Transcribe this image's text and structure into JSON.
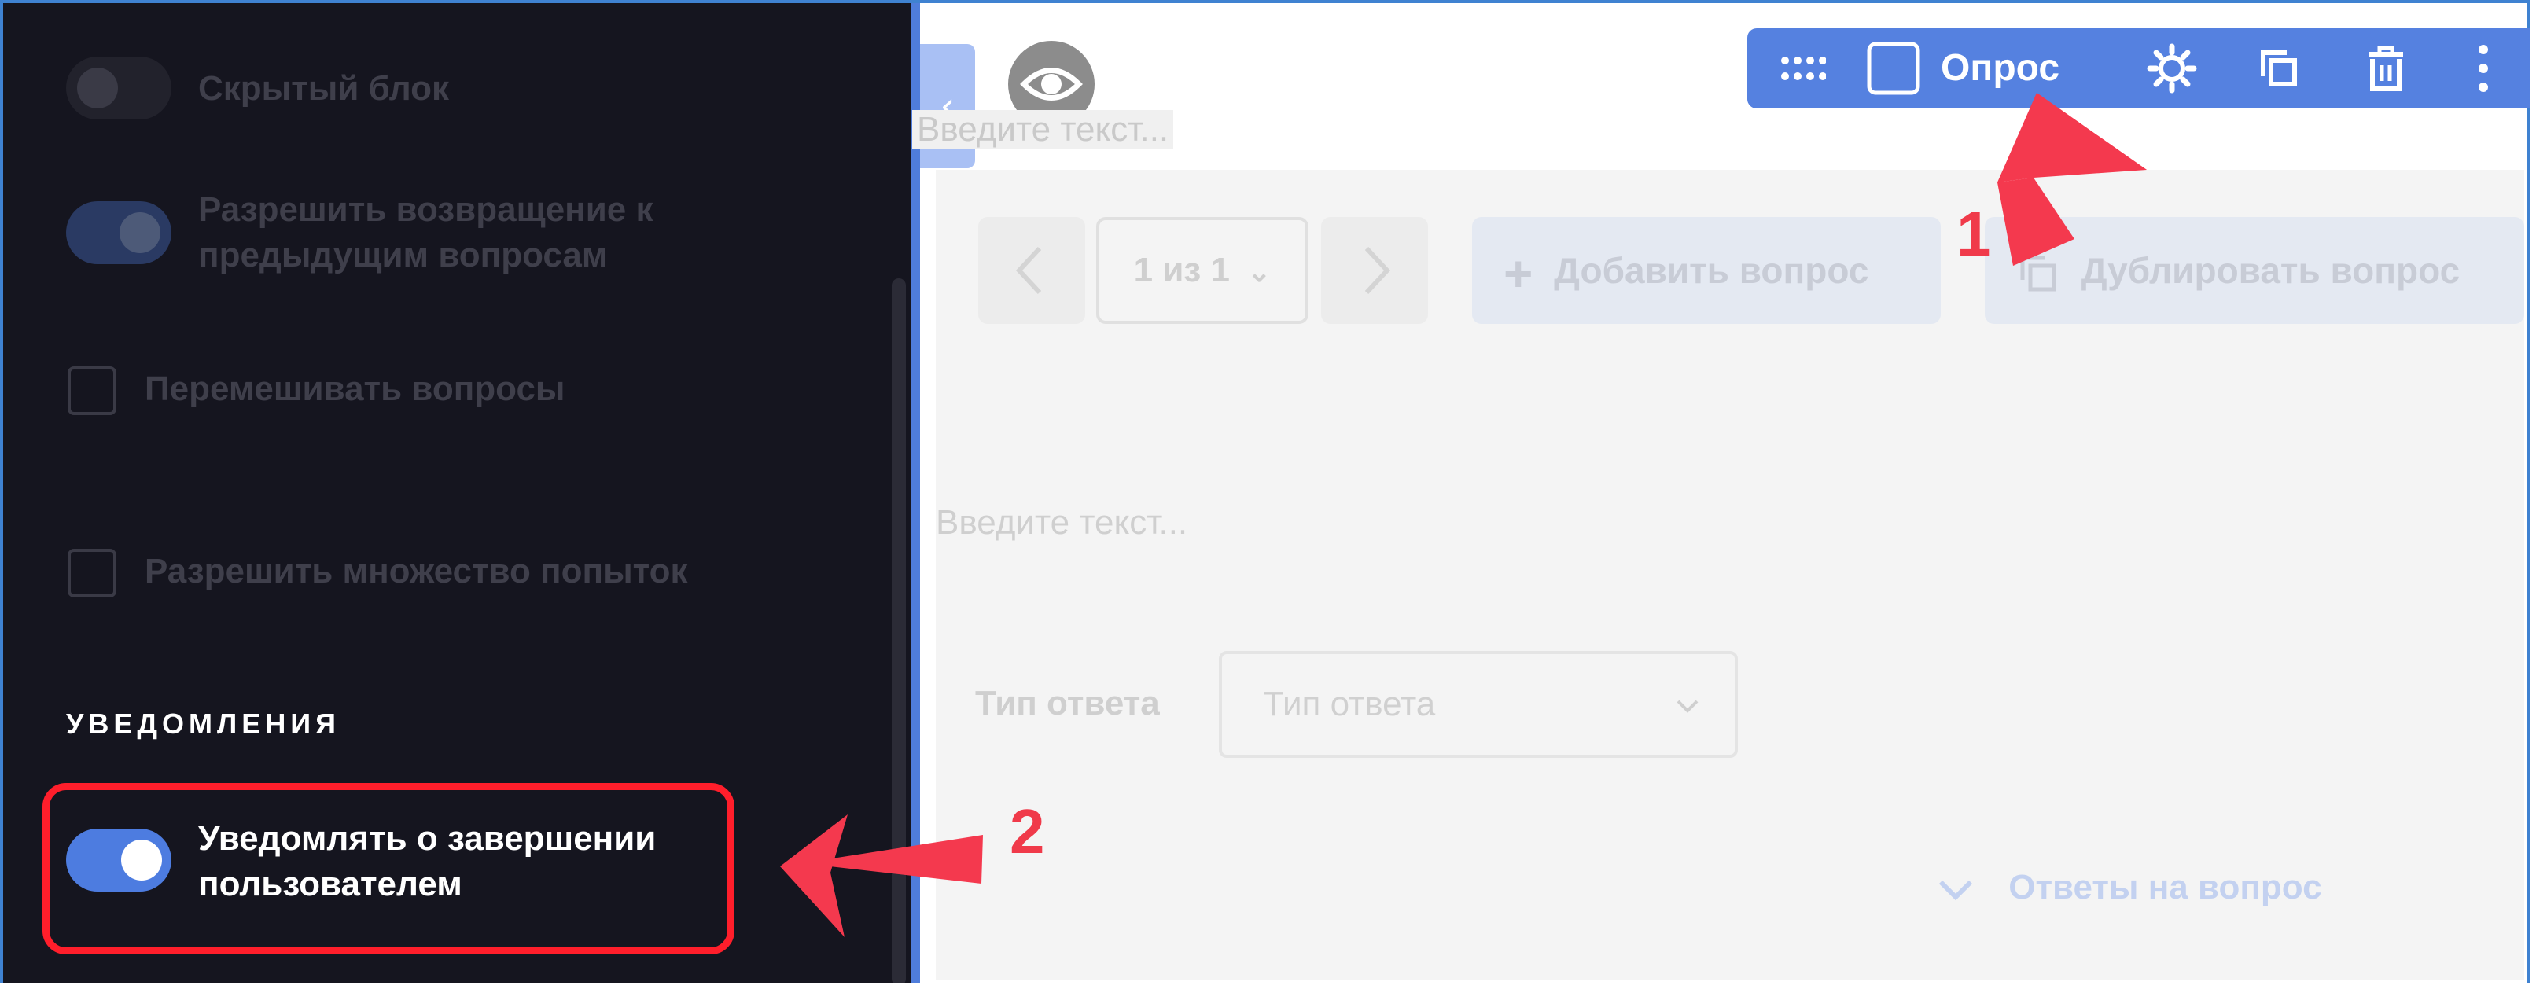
{
  "sidebar": {
    "options": [
      {
        "label": "Скрытый блок",
        "control": "toggle",
        "state": "off"
      },
      {
        "label_line1": "Разрешить возвращение к",
        "label_line2": "предыдущим вопросам",
        "control": "toggle",
        "state": "on"
      },
      {
        "label": "Перемешивать вопросы",
        "control": "checkbox",
        "state": "unchecked"
      },
      {
        "label": "Разрешить множество попыток",
        "control": "checkbox",
        "state": "unchecked"
      }
    ],
    "section_title": "УВЕДОМЛЕНИЯ",
    "notify": {
      "label_line1": "Уведомлять о завершении",
      "label_line2": "пользователем",
      "state": "on"
    }
  },
  "toolbar": {
    "label": "Опрос",
    "icons": [
      "drag-grid-icon",
      "checkbox-icon",
      "gear-icon",
      "copy-icon",
      "trash-icon",
      "more-vertical-icon"
    ],
    "color": "#5581e0"
  },
  "editor": {
    "top_placeholder": "Введите текст...",
    "pager": "1 из 1",
    "add_question": "Добавить вопрос",
    "duplicate_question": "Дублировать вопрос",
    "question_placeholder": "Введите текст...",
    "answer_type_label": "Тип ответа",
    "answer_type_value": "Тип ответа",
    "answers_link": "Ответы на вопрос"
  },
  "annotations": {
    "marker_1": "1",
    "marker_2": "2",
    "color": "#f03a4a"
  }
}
